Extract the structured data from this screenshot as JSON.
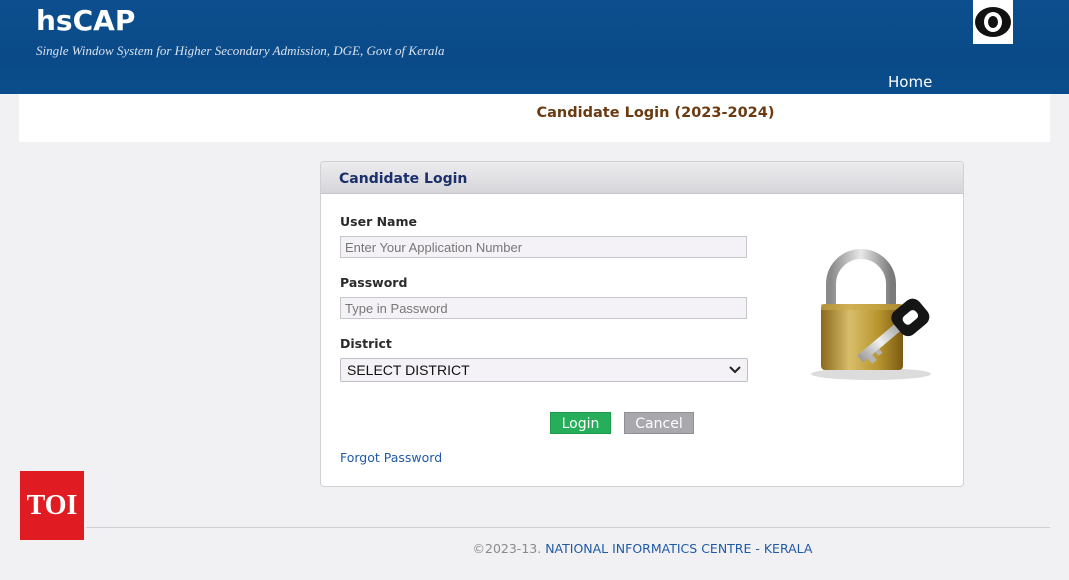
{
  "header": {
    "title": "hsCAP",
    "subtitle": "Single Window System for Higher Secondary Admission, DGE, Govt of Kerala",
    "nav_home": "Home",
    "accessibility_icon": "eye-icon"
  },
  "page": {
    "title": "Candidate Login (2023-2024)"
  },
  "login": {
    "panel_title": "Candidate Login",
    "username_label": "User Name",
    "username_placeholder": "Enter Your Application Number",
    "password_label": "Password",
    "password_placeholder": "Type in Password",
    "district_label": "District",
    "district_selected": "SELECT DISTRICT",
    "login_button": "Login",
    "cancel_button": "Cancel",
    "forgot_link": "Forgot Password",
    "illustration_icon": "padlock-key-icon"
  },
  "badge": {
    "text": "TOI"
  },
  "footer": {
    "year": "©2023-13.",
    "org": "NATIONAL INFORMATICS CENTRE - KERALA"
  },
  "colors": {
    "header_blue": "#0a4a88",
    "title_brown": "#6b3a10",
    "panel_title_navy": "#1a2f6b",
    "login_green": "#27ae5a",
    "cancel_grey": "#a8a8ad",
    "link_blue": "#1f5aa6",
    "badge_red": "#e01b22"
  }
}
